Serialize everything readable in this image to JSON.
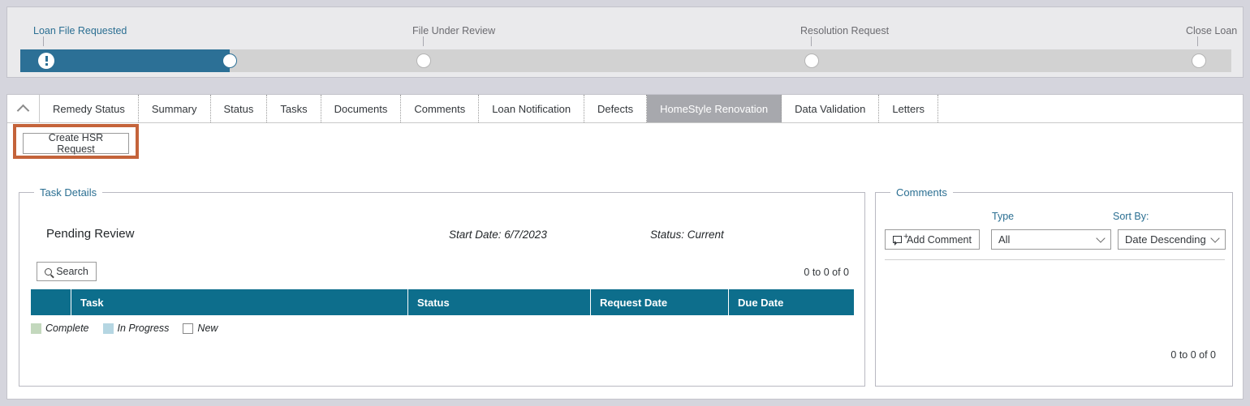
{
  "milestones": {
    "items": [
      {
        "label": "Loan File Requested",
        "state": "current",
        "pct": 0.0
      },
      {
        "label": "File Under Review",
        "state": "upcoming",
        "pct": 33.3
      },
      {
        "label": "Resolution Request",
        "state": "upcoming",
        "pct": 65.3
      },
      {
        "label": "Close Loan",
        "state": "upcoming",
        "pct": 97.3
      }
    ],
    "fill_percent": 17,
    "fill_color": "#2c7096",
    "track_color": "#d2d2d2"
  },
  "tabs": {
    "collapse_icon": "chevron-up-icon",
    "items": [
      {
        "label": "Remedy Status",
        "active": false
      },
      {
        "label": "Summary",
        "active": false
      },
      {
        "label": "Status",
        "active": false
      },
      {
        "label": "Tasks",
        "active": false
      },
      {
        "label": "Documents",
        "active": false
      },
      {
        "label": "Comments",
        "active": false
      },
      {
        "label": "Loan Notification",
        "active": false
      },
      {
        "label": "Defects",
        "active": false
      },
      {
        "label": "HomeStyle Renovation",
        "active": true
      },
      {
        "label": "Data Validation",
        "active": false
      },
      {
        "label": "Letters",
        "active": false
      }
    ],
    "active_bg": "#a7a8ad"
  },
  "actions": {
    "create_hsr_label": "Create HSR Request",
    "highlight_color": "#c4633a"
  },
  "task_details": {
    "legend": "Task Details",
    "task_name": "Pending Review",
    "start_date": "Start Date: 6/7/2023",
    "status": "Status: Current",
    "search_label": "Search",
    "search_icon": "search-icon",
    "pager": "0 to 0 of 0",
    "table": {
      "header_color": "#0d6e8c",
      "columns": [
        "",
        "Task",
        "Status",
        "Request Date",
        "Due Date"
      ],
      "rows": []
    },
    "status_legend": [
      {
        "label": "Complete",
        "color": "#c3d8bd"
      },
      {
        "label": "In Progress",
        "color": "#b5d6e2"
      },
      {
        "label": "New",
        "color": "#ffffff"
      }
    ]
  },
  "comments": {
    "legend": "Comments",
    "add_comment_label": "Add Comment",
    "add_comment_icon": "comment-plus-icon",
    "type_label": "Type",
    "type_value": "All",
    "sort_label": "Sort By:",
    "sort_value": "Date Descending",
    "pager": "0 to 0 of 0"
  }
}
